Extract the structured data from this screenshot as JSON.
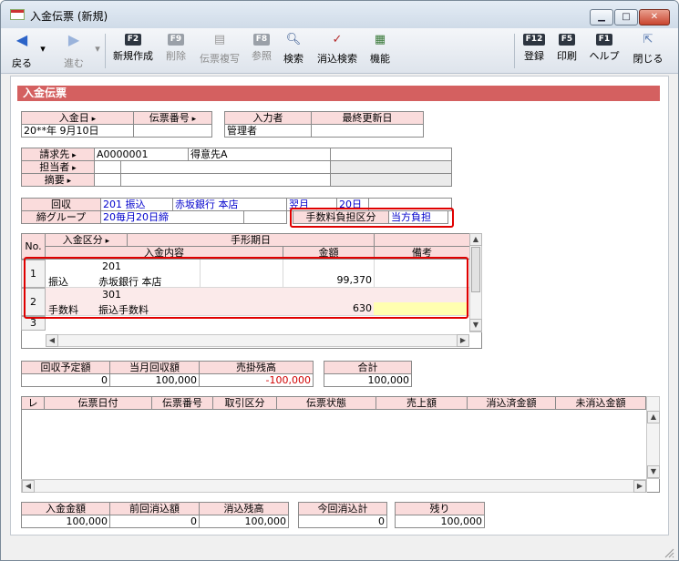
{
  "window": {
    "title": "入金伝票 (新規)"
  },
  "toolbar": {
    "back": "戻る",
    "forward": "進む",
    "new": {
      "key": "F2",
      "label": "新規作成"
    },
    "delete": {
      "key": "F9",
      "label": "削除"
    },
    "copy": {
      "label": "伝票複写"
    },
    "ref": {
      "key": "F8",
      "label": "参照"
    },
    "search": {
      "label": "検索"
    },
    "clear_search": {
      "label": "消込検索"
    },
    "func": {
      "label": "機能"
    },
    "register": {
      "key": "F12",
      "label": "登録"
    },
    "print": {
      "key": "F5",
      "label": "印刷"
    },
    "help": {
      "key": "F1",
      "label": "ヘルプ"
    },
    "close": {
      "label": "閉じる"
    }
  },
  "section_title": "入金伝票",
  "header": {
    "deposit_date_label": "入金日",
    "slip_no_label": "伝票番号",
    "input_by_label": "入力者",
    "last_updated_label": "最終更新日",
    "deposit_date": "20**年 9月10日",
    "slip_no": "",
    "input_by": "管理者",
    "last_updated": ""
  },
  "customer": {
    "billing_label": "請求先",
    "staff_label": "担当者",
    "summary_label": "摘要",
    "billing_code": "A0000001",
    "billing_name": "得意先A"
  },
  "collection": {
    "collection_label": "回収",
    "close_group_label": "締グループ",
    "collection_code": "201",
    "collection_method": "振込",
    "bank": "赤坂銀行 本店",
    "month": "翌月",
    "day": "20日",
    "close_group_code": "20",
    "close_group_name": "毎月20日締",
    "fee_label": "手数料負担区分",
    "fee_value": "当方負担"
  },
  "detail_grid": {
    "col_no": "No.",
    "col_type": "入金区分",
    "col_due": "手形期日",
    "col_content": "入金内容",
    "col_amount": "金額",
    "col_note": "備考",
    "rows": [
      {
        "no": "1",
        "code": "201",
        "type": "振込",
        "content": "赤坂銀行 本店",
        "amount": "99,370",
        "note": ""
      },
      {
        "no": "2",
        "code": "301",
        "type": "手数料",
        "content": "振込手数料",
        "amount": "630",
        "note": ""
      },
      {
        "no": "3"
      }
    ]
  },
  "totals1": {
    "planned_label": "回収予定額",
    "current_label": "当月回収額",
    "balance_label": "売掛残高",
    "total_label": "合計",
    "planned": "0",
    "current": "100,000",
    "balance": "-100,000",
    "total": "100,000"
  },
  "match_grid": {
    "col_check": "レ",
    "col_date": "伝票日付",
    "col_no": "伝票番号",
    "col_type": "取引区分",
    "col_status": "伝票状態",
    "col_sales": "売上額",
    "col_cleared": "消込済金額",
    "col_uncleared": "未消込金額"
  },
  "totals2": {
    "deposit_label": "入金金額",
    "prev_label": "前回消込額",
    "remaining_label": "消込残高",
    "current_label": "今回消込計",
    "rest_label": "残り",
    "deposit": "100,000",
    "prev": "0",
    "remaining": "100,000",
    "current": "0",
    "rest": "100,000"
  }
}
